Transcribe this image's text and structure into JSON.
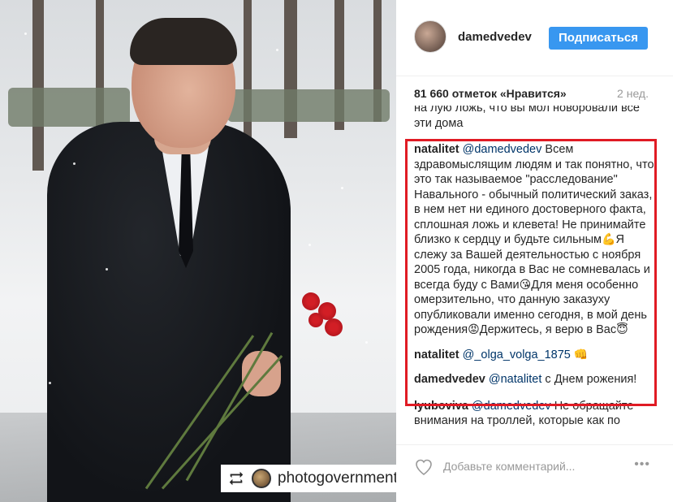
{
  "photo": {
    "watermark_label": "photogovernment",
    "repost_icon": "repost-icon"
  },
  "post": {
    "username": "damedvedev",
    "follow_label": "Подписаться",
    "likes": "81 660 отметок «Нравится»",
    "time": "2 нед.",
    "accent_color": "#3897f0",
    "highlight_color": "#e01b24"
  },
  "comments": {
    "partial_top": "на лую ложь, что вы мол новоровали все эти дома",
    "c1": {
      "user": "natalitet",
      "mention": "@damedvedev",
      "text_a": " Всем здравомыслящим людям и так понятно, что это так называемое \"расследование\" Навального - обычный политический заказ, в нем нет ни единого достоверного факта, сплошная ложь и клевета! Не принимайте близко к сердцу и будьте сильным",
      "emoji_a": "💪",
      "text_b": "Я слежу за Вашей деятельностью с ноября 2005 года, никогда в Вас не сомневалась и всегда буду с Вами",
      "emoji_b": "😘",
      "text_c": "Для меня особенно омерзительно, что данную заказуху опубликовали именно сегодня, в мой день рождения",
      "emoji_c": "😡",
      "text_d": "Держитесь, я верю в Вас",
      "emoji_d": "😇"
    },
    "c2": {
      "user": "natalitet",
      "mention": "@_olga_volga_1875",
      "emoji": "👊"
    },
    "c3": {
      "user": "damedvedev",
      "mention": "@natalitet",
      "text": " с Днем рожения!"
    },
    "c4": {
      "user": "lyubovivа",
      "mention": "@damedvedev",
      "text": " Не обращайте внимания на троллей, которые как по"
    }
  },
  "footer": {
    "comment_placeholder": "Добавьте комментарий...",
    "like_icon": "heart-icon",
    "more_label": "•••"
  }
}
